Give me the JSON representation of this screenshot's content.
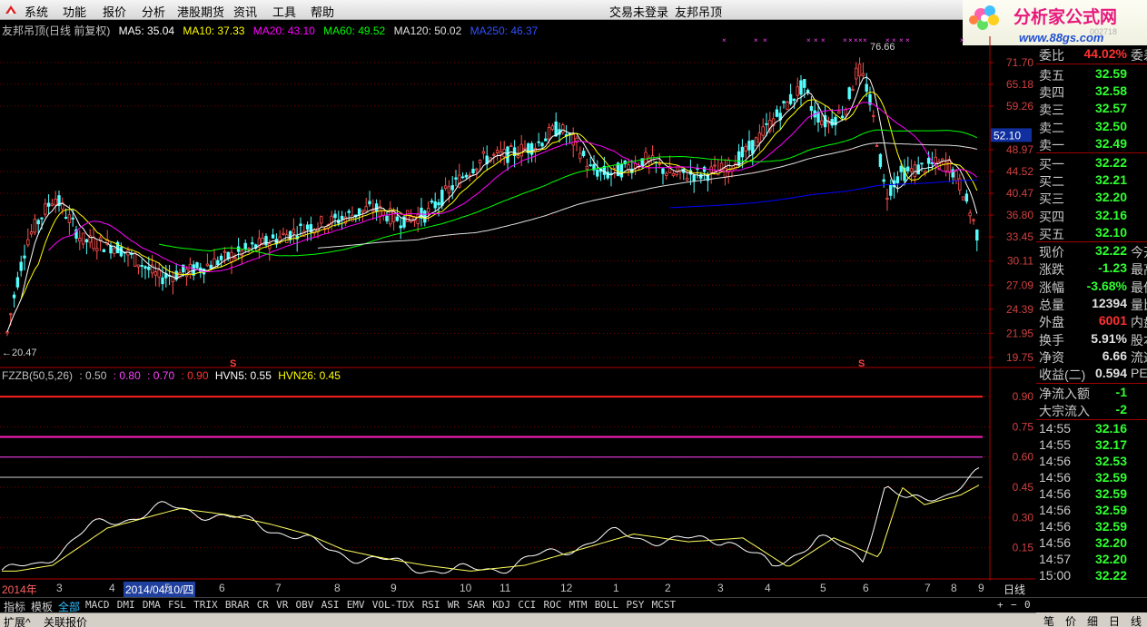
{
  "menu": [
    "系统",
    "功能",
    "报价",
    "分析",
    "港股期货",
    "资讯",
    "工具",
    "帮助"
  ],
  "status": "交易未登录",
  "stock_name": "友邦吊顶",
  "brand": {
    "name": "分析家公式网",
    "url": "www.88gs.com",
    "code": "002718"
  },
  "legend": {
    "title": "友邦吊顶(日线 前复权)",
    "ma5": "MA5: 35.04",
    "ma10": "MA10: 37.33",
    "ma20": "MA20: 43.10",
    "ma60": "MA60: 49.52",
    "ma120": "MA120: 50.02",
    "ma250": "MA250: 46.37"
  },
  "indicator_legend": {
    "name": "FZZB(50,5,26)",
    "v1": ": 0.50",
    "v2": ": 0.80",
    "v3": ": 0.70",
    "v4": ": 0.90",
    "hvn5": "HVN5: 0.55",
    "hvn26": "HVN26: 0.45"
  },
  "annotations": {
    "high": "76.66",
    "low": "←20.47",
    "current": "52.10",
    "signal": "S"
  },
  "price_axis": [
    "71.70",
    "65.18",
    "59.26",
    "52.10",
    "48.97",
    "44.52",
    "40.47",
    "36.80",
    "33.45",
    "30.11",
    "27.09",
    "24.39",
    "21.95",
    "19.75"
  ],
  "ind_axis": [
    "0.90",
    "0.75",
    "0.60",
    "0.45",
    "0.30",
    "0.15"
  ],
  "time_axis": [
    "2014年",
    "3",
    "4",
    "5",
    "6",
    "7",
    "8",
    "9",
    "10",
    "11",
    "12",
    "1",
    "2",
    "3",
    "4",
    "5",
    "6",
    "7",
    "8",
    "9"
  ],
  "selected_date": "2014/04/10/四",
  "period": "日线",
  "side": {
    "ratio_label": "委比",
    "ratio_value": "44.02%",
    "ratio_extra": "委差",
    "asks": [
      {
        "label": "卖五",
        "price": "32.59"
      },
      {
        "label": "卖四",
        "price": "32.58"
      },
      {
        "label": "卖三",
        "price": "32.57"
      },
      {
        "label": "卖二",
        "price": "32.50"
      },
      {
        "label": "卖一",
        "price": "32.49"
      }
    ],
    "bids": [
      {
        "label": "买一",
        "price": "32.22"
      },
      {
        "label": "买二",
        "price": "32.21"
      },
      {
        "label": "买三",
        "price": "32.20"
      },
      {
        "label": "买四",
        "price": "32.16"
      },
      {
        "label": "买五",
        "price": "32.10"
      }
    ],
    "stats": [
      {
        "label": "现价",
        "value": "32.22",
        "extra": "今开"
      },
      {
        "label": "涨跌",
        "value": "-1.23",
        "extra": "最高"
      },
      {
        "label": "涨幅",
        "value": "-3.68%",
        "extra": "最低"
      },
      {
        "label": "总量",
        "value": "12394",
        "extra": "量比"
      },
      {
        "label": "外盘",
        "value": "6001",
        "extra": "内盘"
      },
      {
        "label": "换手",
        "value": "5.91%",
        "extra": "股本"
      },
      {
        "label": "净资",
        "value": "6.66",
        "extra": "流通"
      },
      {
        "label": "收益(二)",
        "value": "0.594",
        "extra": "PE"
      }
    ],
    "flows": [
      {
        "label": "净流入额",
        "value": "-1"
      },
      {
        "label": "大宗流入",
        "value": "-2"
      }
    ],
    "ticks": [
      {
        "time": "14:55",
        "price": "32.16"
      },
      {
        "time": "14:55",
        "price": "32.17"
      },
      {
        "time": "14:56",
        "price": "32.53"
      },
      {
        "time": "14:56",
        "price": "32.59"
      },
      {
        "time": "14:56",
        "price": "32.59"
      },
      {
        "time": "14:56",
        "price": "32.59"
      },
      {
        "time": "14:56",
        "price": "32.59"
      },
      {
        "time": "14:56",
        "price": "32.20"
      },
      {
        "time": "14:57",
        "price": "32.20"
      },
      {
        "time": "15:00",
        "price": "32.22"
      }
    ],
    "side_tabs": [
      "笔",
      "价",
      "细",
      "日",
      "线"
    ]
  },
  "indicator_tabs": [
    "指标",
    "模板",
    "全部",
    "MACD",
    "DMI",
    "DMA",
    "FSL",
    "TRIX",
    "BRAR",
    "CR",
    "VR",
    "OBV",
    "ASI",
    "EMV",
    "VOL-TDX",
    "RSI",
    "WR",
    "SAR",
    "KDJ",
    "CCI",
    "ROC",
    "MTM",
    "BOLL",
    "PSY",
    "MCST"
  ],
  "zoom_buttons": [
    "+",
    "−",
    "0"
  ],
  "bottom_items": [
    "扩展^",
    "关联报价"
  ],
  "colors": {
    "up": "#ff5050",
    "down": "#54ffff",
    "ma5": "#ffffff",
    "ma10": "#ffff00",
    "ma20": "#ff00ff",
    "ma60": "#00ff00",
    "ma120": "#e0e0e0",
    "ma250": "#0000ff",
    "grid": "#800000",
    "axis": "#b00000"
  }
}
